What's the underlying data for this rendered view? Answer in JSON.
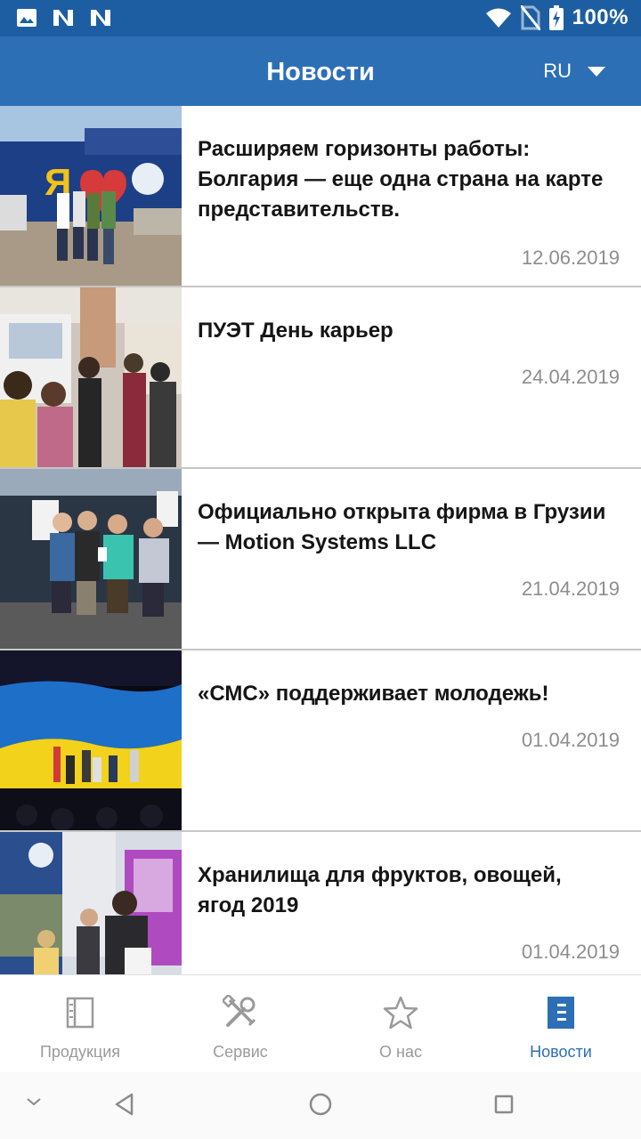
{
  "status_bar": {
    "battery_text": "100%"
  },
  "app_bar": {
    "title": "Новости",
    "language": "RU"
  },
  "news": [
    {
      "title": "Расширяем горизонты работы: Болгария — еще одна страна на карте представительств.",
      "date": "12.06.2019"
    },
    {
      "title": "ПУЭТ День карьер",
      "date": "24.04.2019"
    },
    {
      "title": "Официально открыта фирма в Грузии — Motion Systems LLC",
      "date": "21.04.2019"
    },
    {
      "title": "«СМС» поддерживает молодежь!",
      "date": "01.04.2019"
    },
    {
      "title": "Хранилища для фруктов, овощей, ягод 2019",
      "date": "01.04.2019"
    }
  ],
  "bottom_nav": [
    {
      "label": "Продукция",
      "icon": "catalog-icon",
      "active": false
    },
    {
      "label": "Сервис",
      "icon": "tools-icon",
      "active": false
    },
    {
      "label": "О нас",
      "icon": "star-icon",
      "active": false
    },
    {
      "label": "Новости",
      "icon": "news-icon",
      "active": true
    }
  ],
  "colors": {
    "status_bar": "#1d5ea2",
    "app_bar": "#2c6fb5",
    "active_nav": "#2c6fb5",
    "inactive_nav": "#9a9a9a",
    "date_text": "#8d8d8d"
  }
}
